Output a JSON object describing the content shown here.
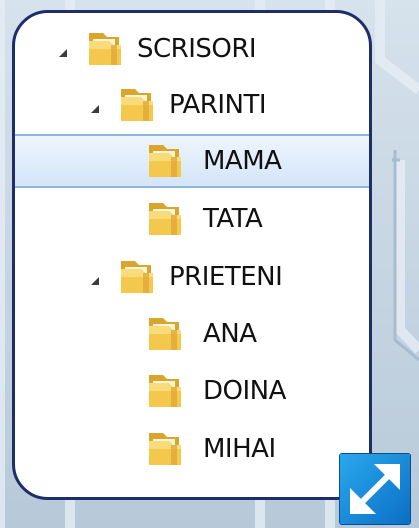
{
  "tree": {
    "items": [
      {
        "label": "SCRISORI",
        "level": 0,
        "expanded": true,
        "selected": false
      },
      {
        "label": "PARINTI",
        "level": 1,
        "expanded": true,
        "selected": false
      },
      {
        "label": "MAMA",
        "level": 2,
        "expanded": false,
        "selected": true
      },
      {
        "label": "TATA",
        "level": 2,
        "expanded": false,
        "selected": false
      },
      {
        "label": "PRIETENI",
        "level": 1,
        "expanded": true,
        "selected": false
      },
      {
        "label": "ANA",
        "level": 2,
        "expanded": false,
        "selected": false
      },
      {
        "label": "DOINA",
        "level": 2,
        "expanded": false,
        "selected": false
      },
      {
        "label": "MIHAI",
        "level": 2,
        "expanded": false,
        "selected": false
      }
    ]
  },
  "colors": {
    "panel_border": "#1f2d6b",
    "selection": "#d4e5f8",
    "folder": "#f0c24a",
    "expand_button": "#1a8fdd"
  },
  "icons": {
    "folder": "folder-icon",
    "expanded_arrow": "expanded-arrow-icon",
    "expand": "fullscreen-expand-icon"
  }
}
